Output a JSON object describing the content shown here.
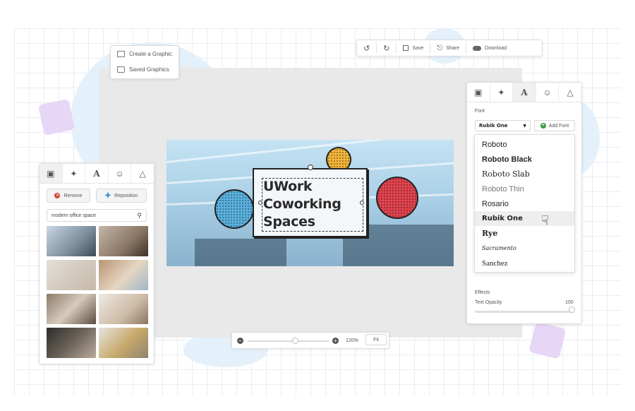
{
  "menu": {
    "items": [
      {
        "label": "Create a Graphic",
        "icon": "image-icon"
      },
      {
        "label": "Saved Graphics",
        "icon": "folder-icon"
      }
    ]
  },
  "toolbar": {
    "save_label": "Save",
    "share_label": "Share",
    "download_label": "Download"
  },
  "canvas": {
    "lines": [
      "UWork",
      "Coworking",
      "Spaces"
    ],
    "circle_colors": {
      "blue": "#5ab0de",
      "yellow": "#f2b53a",
      "red": "#e0434f"
    }
  },
  "left_panel": {
    "tabs": [
      "image-tab",
      "magic-wand-tab",
      "text-tab",
      "emoji-tab",
      "shape-tab"
    ],
    "remove_label": "Remove",
    "reposition_label": "Reposition",
    "search_value": "modern office space"
  },
  "right_panel": {
    "font_heading": "Font",
    "selected_font": "Rubik One",
    "add_font_label": "Add Font",
    "fonts": [
      "Roboto",
      "Roboto Black",
      "Roboto Slab",
      "Roboto Thin",
      "Rosario",
      "Rubik One",
      "Rye",
      "Sacramento",
      "Sanchez"
    ],
    "effects_heading": "Effects",
    "opacity_label": "Text Opacity",
    "opacity_value": "100"
  },
  "zoom": {
    "value": "120%",
    "fit_label": "Fit"
  }
}
